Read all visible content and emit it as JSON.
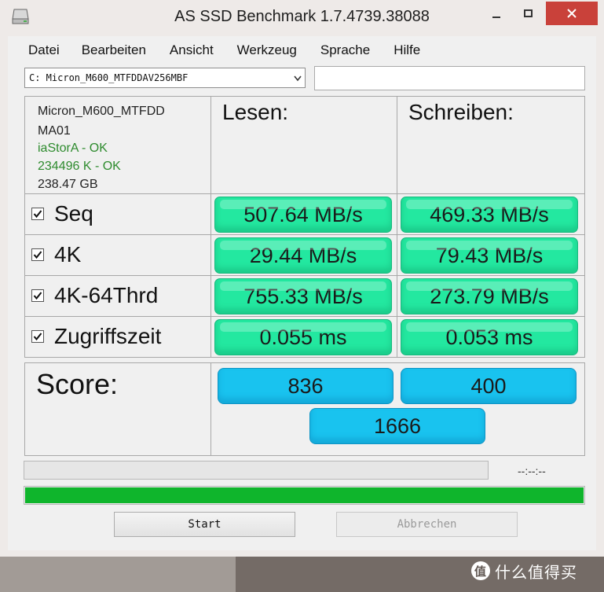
{
  "window": {
    "title": "AS SSD Benchmark 1.7.4739.38088"
  },
  "menu": [
    "Datei",
    "Bearbeiten",
    "Ansicht",
    "Werkzeug",
    "Sprache",
    "Hilfe"
  ],
  "drive": {
    "selected": "C: Micron_M600_MTFDDAV256MBF",
    "field_value": ""
  },
  "info": {
    "model": "Micron_M600_MTFDD",
    "firmware": "MA01",
    "driver": "iaStorA - OK",
    "alignment": "234496 K - OK",
    "capacity": "238.47 GB"
  },
  "headers": {
    "read": "Lesen:",
    "write": "Schreiben:"
  },
  "rows": [
    {
      "label": "Seq",
      "checked": true,
      "read": "507.64 MB/s",
      "write": "469.33 MB/s"
    },
    {
      "label": "4K",
      "checked": true,
      "read": "29.44 MB/s",
      "write": "79.43 MB/s"
    },
    {
      "label": "4K-64Thrd",
      "checked": true,
      "read": "755.33 MB/s",
      "write": "273.79 MB/s"
    },
    {
      "label": "Zugriffszeit",
      "checked": true,
      "read": "0.055 ms",
      "write": "0.053 ms"
    }
  ],
  "score": {
    "label": "Score:",
    "read": "836",
    "write": "400",
    "total": "1666"
  },
  "progress": {
    "time_text": "--:--:--",
    "top_fraction": 0,
    "bottom_fraction": 1.0
  },
  "buttons": {
    "start": "Start",
    "abort": "Abbrechen"
  },
  "watermark": {
    "logo_char": "值",
    "text": "什么值得买"
  },
  "colors": {
    "value_box": "#23e8a0",
    "score_box": "#19c3ef",
    "progress_fill": "#0fb52c",
    "close_button": "#c9413a",
    "ok_text": "#2e8b2e"
  }
}
